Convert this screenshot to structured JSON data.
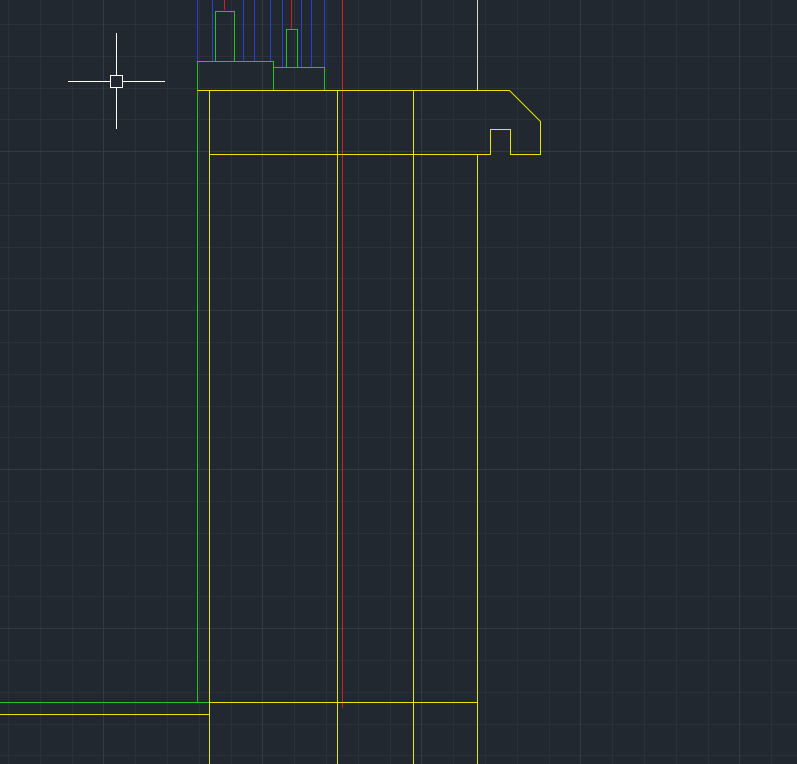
{
  "app": {
    "type": "cad-drawing-viewport",
    "background_color": "#212830"
  },
  "colors": {
    "grid_minor": "#2a313a",
    "grid_major": "#323a45",
    "layer_yellow": "#e6e600",
    "layer_green": "#22c322",
    "layer_red": "#d22020",
    "layer_blue": "#2a3fd6",
    "layer_white": "#d8d8d8",
    "cursor": "#ffffff"
  },
  "drawing": {
    "layers": [
      "yellow",
      "green",
      "red",
      "blue",
      "white"
    ]
  },
  "cursor": {
    "type": "crosshair-with-pickbox",
    "icon": "crosshair-cursor-icon"
  }
}
